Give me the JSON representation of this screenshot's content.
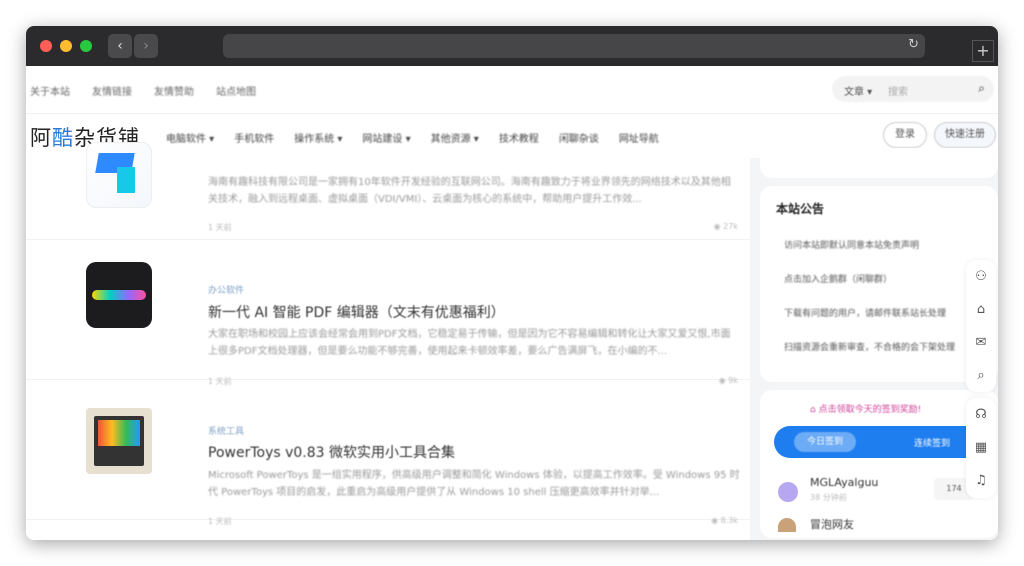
{
  "browser": {
    "back": "‹",
    "forward": "›",
    "reload": "↻",
    "new_tab": "+"
  },
  "top_links": [
    "关于本站",
    "友情链接",
    "友情赞助",
    "站点地图"
  ],
  "search": {
    "scope": "文章 ▾",
    "placeholder": "搜索",
    "icon": "search-icon"
  },
  "logo": {
    "pre": "阿",
    "accent": "酷",
    "post": "杂货铺"
  },
  "menu": [
    "电脑软件 ▾",
    "手机软件",
    "操作系统 ▾",
    "网站建设 ▾",
    "其他资源 ▾",
    "技术教程",
    "闲聊杂谈",
    "网址导航"
  ],
  "auth": {
    "login": "登录",
    "register": "快速注册"
  },
  "articles": [
    {
      "category": "",
      "title": "",
      "desc": "海南有趣科技有限公司是一家拥有10年软件开发经验的互联网公司。海南有趣致力于将业界领先的网络技术以及其他相关技术，融入到远程桌面、虚拟桌面（VDI/VMI）、云桌面为核心的系统中，帮助用户提升工作效...",
      "time": "1 天前",
      "views": "◉ 27k"
    },
    {
      "category": "办公软件",
      "title": "新一代 AI 智能 PDF 编辑器（文末有优惠福利）",
      "desc": "大家在职场和校园上应该会经常会用到PDF文档，它稳定易于传输，但是因为它不容易编辑和转化让大家又爱又恨,市面上很多PDF文档处理器，但是要么功能不够完善，使用起来卡顿效率差，要么广告满屏飞，在小编的不...",
      "time": "1 天前",
      "views": "◉ 9k"
    },
    {
      "category": "系统工具",
      "title": "PowerToys v0.83 微软实用小工具合集",
      "desc": "Microsoft PowerToys 是一组实用程序，供高级用户调整和简化 Windows 体验，以提高工作效率。受 Windows 95 时代 PowerToys 项目的启发，此重启为高级用户提供了从 Windows 10 shell 压缩更高效率并针对举...",
      "time": "1 天前",
      "views": "◉ 8.3k"
    }
  ],
  "notice": {
    "title": "本站公告",
    "items": [
      "访问本站即默认同意本站免责声明",
      "点击加入企鹅群（闲聊群）",
      "下载有问题的用户，请邮件联系站长处理",
      "扫描资源会重新审查，不合格的会下架处理"
    ]
  },
  "checkin": {
    "prompt": "点击领取今天的签到奖励!",
    "today": "今日签到",
    "rank": "连续签到"
  },
  "users": [
    {
      "name": "MGLAyalguu",
      "time": "38 分钟前",
      "badge": "174"
    },
    {
      "name": "冒泡网友",
      "time": "",
      "badge": ""
    }
  ]
}
